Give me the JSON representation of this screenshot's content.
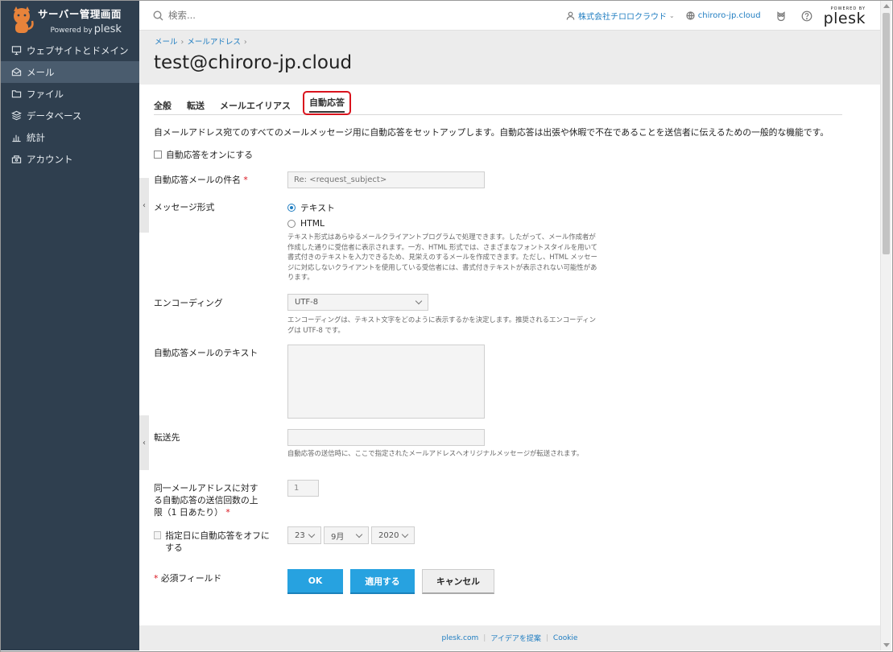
{
  "sidebar": {
    "brand_title": "サーバー管理画面",
    "brand_powered": "Powered by",
    "brand_plesk": "plesk",
    "items": [
      {
        "label": "ウェブサイトとドメイン",
        "icon": "monitor-icon"
      },
      {
        "label": "メール",
        "icon": "mail-icon",
        "active": true
      },
      {
        "label": "ファイル",
        "icon": "folder-icon"
      },
      {
        "label": "データベース",
        "icon": "database-icon"
      },
      {
        "label": "統計",
        "icon": "chart-icon"
      },
      {
        "label": "アカウント",
        "icon": "account-icon"
      }
    ]
  },
  "topbar": {
    "search_placeholder": "検索...",
    "account": "株式会社チロロクラウド",
    "domain": "chiroro-jp.cloud",
    "powered_by": "POWERED BY",
    "plesk": "plesk"
  },
  "header": {
    "breadcrumb": [
      "メール",
      "メールアドレス"
    ],
    "title": "test@chiroro-jp.cloud"
  },
  "tabs": [
    "全般",
    "転送",
    "メールエイリアス",
    "自動応答"
  ],
  "form": {
    "intro": "自メールアドレス宛てのすべてのメールメッセージ用に自動応答をセットアップします。自動応答は出張や休暇で不在であることを送信者に伝えるための一般的な機能です。",
    "enable_label": "自動応答をオンにする",
    "subject_label": "自動応答メールの件名",
    "subject_placeholder": "Re: <request_subject>",
    "format_label": "メッセージ形式",
    "format_text": "テキスト",
    "format_html": "HTML",
    "format_hint": "テキスト形式はあらゆるメールクライアントプログラムで処理できます。したがって、メール作成者が作成した通りに受信者に表示されます。一方、HTML 形式では、さまざまなフォントスタイルを用いて書式付きのテキストを入力できるため、見栄えのするメールを作成できます。ただし、HTML メッセージに対応しないクライアントを使用している受信者には、書式付きテキストが表示されない可能性があります。",
    "encoding_label": "エンコーディング",
    "encoding_value": "UTF-8",
    "encoding_hint": "エンコーディングは、テキスト文字をどのように表示するかを決定します。推奨されるエンコーディングは UTF-8 です。",
    "text_label": "自動応答メールのテキスト",
    "forward_label": "転送先",
    "forward_hint": "自動応答の送信時に、ここで指定されたメールアドレスへオリジナルメッセージが転送されます。",
    "limit_label": "同一メールアドレスに対する自動応答の送信回数の上限（1 日あたり）",
    "limit_value": "1",
    "offdate_label": "指定日に自動応答をオフにする",
    "day": "23",
    "month": "9月",
    "year": "2020",
    "required_note": "必須フィールド",
    "required_mark": "*"
  },
  "buttons": {
    "ok": "OK",
    "apply": "適用する",
    "cancel": "キャンセル"
  },
  "footer": {
    "links": [
      "plesk.com",
      "アイデアを提案",
      "Cookie"
    ]
  },
  "colors": {
    "sidebar_bg": "#2f3f4f",
    "accent": "#27a2e0",
    "link": "#1f7dc1",
    "highlight": "#d9131d"
  }
}
